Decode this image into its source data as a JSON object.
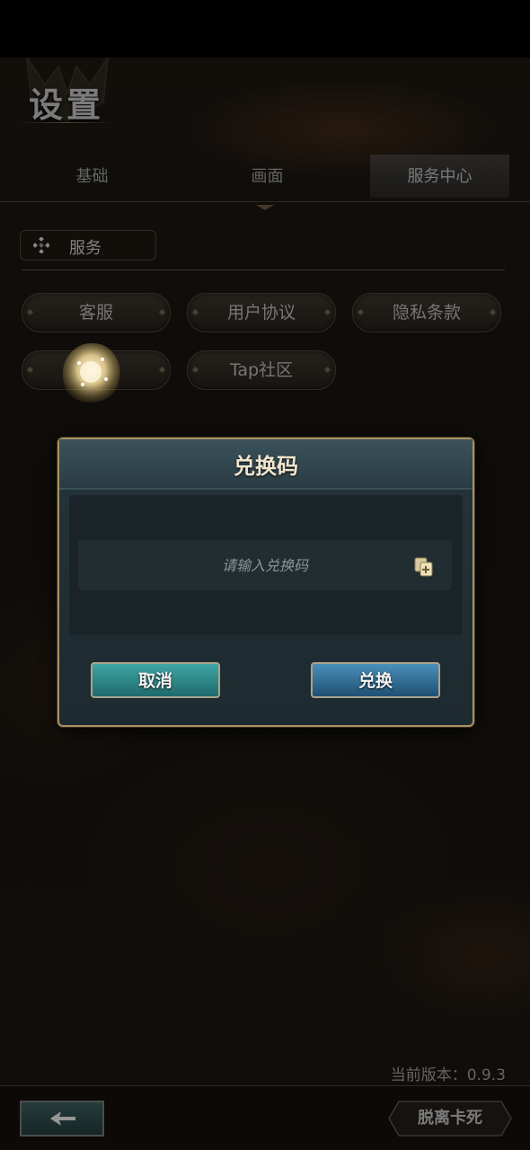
{
  "page": {
    "title": "设置"
  },
  "tabs": [
    {
      "label": "基础",
      "active": false
    },
    {
      "label": "画面",
      "active": false
    },
    {
      "label": "服务中心",
      "active": true
    }
  ],
  "service": {
    "section_title": "服务",
    "buttons": [
      "客服",
      "用户协议",
      "隐私条款",
      "",
      "Tap社区"
    ]
  },
  "dialog": {
    "title": "兑换码",
    "input_placeholder": "请输入兑换码",
    "input_value": "",
    "cancel_label": "取消",
    "confirm_label": "兑换"
  },
  "footer": {
    "version": "当前版本：0.9.3",
    "unstuck_label": "脱离卡死"
  },
  "icons": {
    "tab_indicator": "diamond-ornament-icon",
    "section": "four-diamond-icon",
    "paste": "paste-icon",
    "back": "back-arrow-icon",
    "orb": "floating-assistant-orb-icon"
  },
  "colors": {
    "accent_gold": "#a99162",
    "cancel_teal": "#2f8a8a",
    "confirm_blue": "#2f6f95"
  }
}
